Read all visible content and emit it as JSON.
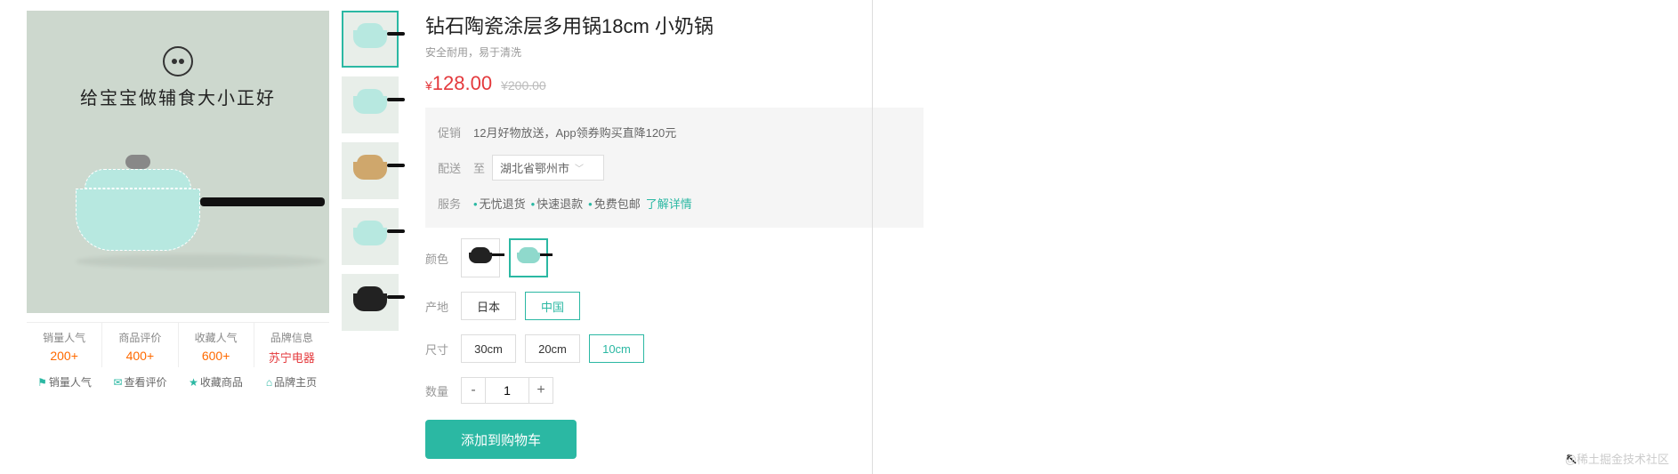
{
  "main_image": {
    "caption": "给宝宝做辅食大小正好"
  },
  "stats": [
    {
      "label": "销量人气",
      "value": "200+",
      "action": "销量人气"
    },
    {
      "label": "商品评价",
      "value": "400+",
      "action": "查看评价"
    },
    {
      "label": "收藏人气",
      "value": "600+",
      "action": "收藏商品"
    },
    {
      "label": "品牌信息",
      "value": "苏宁电器",
      "action": "品牌主页",
      "is_brand": true
    }
  ],
  "product": {
    "title": "钻石陶瓷涂层多用锅18cm 小奶锅",
    "subtitle": "安全耐用，易于清洗",
    "price": "128.00",
    "old_price": "200.00",
    "currency": "¥"
  },
  "promo": {
    "label": "促销",
    "text": "12月好物放送，App领券购买直降120元"
  },
  "delivery": {
    "label": "配送",
    "to": "至",
    "value": "湖北省鄂州市"
  },
  "service": {
    "label": "服务",
    "items": [
      "无忧退货",
      "快速退款",
      "免费包邮"
    ],
    "link": "了解详情"
  },
  "options": {
    "color": {
      "label": "颜色",
      "values": [
        "black",
        "teal"
      ],
      "selected": 1
    },
    "origin": {
      "label": "产地",
      "values": [
        "日本",
        "中国"
      ],
      "selected": 1
    },
    "size": {
      "label": "尺寸",
      "values": [
        "30cm",
        "20cm",
        "10cm"
      ],
      "selected": 2
    },
    "qty": {
      "label": "数量",
      "value": "1"
    }
  },
  "add_to_cart": "添加到购物车",
  "watermark": "@稀土掘金技术社区"
}
